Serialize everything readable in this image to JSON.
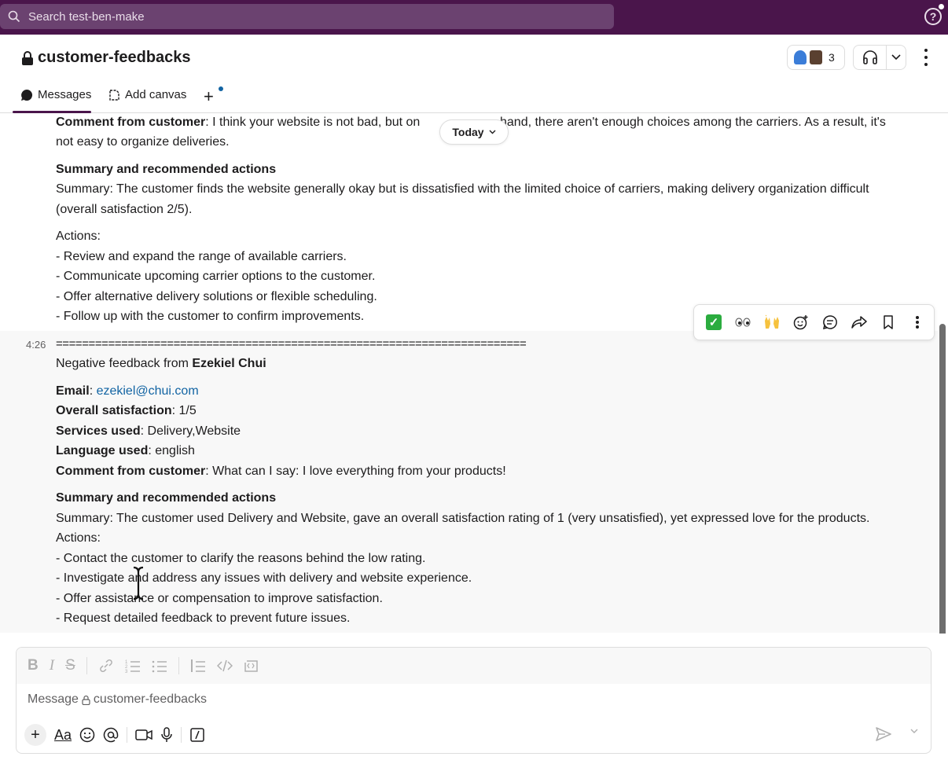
{
  "search": {
    "placeholder": "Search test-ben-make"
  },
  "help": {
    "label": "?"
  },
  "channel": {
    "name": "customer-feedbacks",
    "member_count": "3"
  },
  "tabs": [
    {
      "label": "Messages",
      "icon": "message-bubble-icon"
    },
    {
      "label": "Add canvas",
      "icon": "canvas-icon"
    },
    {
      "label": "+",
      "icon": "plus-icon"
    }
  ],
  "date_divider": {
    "label": "Today"
  },
  "message1": {
    "comment_label": "Comment from customer",
    "comment_line1": ": I think your website is not bad, but on",
    "comment_line1_tail": "hand, there aren't enough choices among the carriers. As a result, it's",
    "comment_line2": "not easy to organize deliveries.",
    "summary_heading": "Summary and recommended actions",
    "summary_line1": "Summary: The customer finds the website generally okay but is dissatisfied with the limited choice of carriers, making delivery organization difficult",
    "summary_line2": "(overall satisfaction 2/5).",
    "actions_heading": "Actions:",
    "actions": [
      "- Review and expand the range of available carriers.",
      "- Communicate upcoming carrier options to the customer.",
      "- Offer alternative delivery solutions or flexible scheduling.",
      "- Follow up with the customer to confirm improvements."
    ]
  },
  "message2": {
    "time": "4:26",
    "divider": "========================================================================",
    "intro": "Negative feedback from ",
    "customer_name": "Ezekiel Chui",
    "email_label": "Email",
    "email": "ezekiel@chui.com",
    "satisfaction_label": "Overall satisfaction",
    "satisfaction": ": 1/5",
    "services_label": "Services used",
    "services": ": Delivery,Website",
    "language_label": "Language used",
    "language": ": english",
    "comment_label": "Comment from customer",
    "comment": ": What can I say: I love everything from your products!",
    "summary_heading": "Summary and recommended actions",
    "summary": "Summary: The customer used Delivery and Website, gave an overall satisfaction rating of 1 (very unsatisfied), yet expressed love for the products.",
    "actions_heading": "Actions:",
    "actions": [
      "- Contact the customer to clarify the reasons behind the low rating.",
      "- Investigate and address any issues with delivery and website experience.",
      "- Offer assistance or compensation to improve satisfaction.",
      "- Request detailed feedback to prevent future issues."
    ]
  },
  "message_actions": [
    "check-reaction-icon",
    "eyes-reaction-icon",
    "raised-hands-reaction-icon",
    "add-reaction-icon",
    "reply-thread-icon",
    "forward-icon",
    "bookmark-icon",
    "more-actions-icon"
  ],
  "composer": {
    "placeholder_prefix": "Message ",
    "placeholder_channel": "customer-feedbacks",
    "format_label": "Aa"
  },
  "colors": {
    "topbar": "#4a154b",
    "link": "#1264a3",
    "check": "#2bac3f"
  }
}
